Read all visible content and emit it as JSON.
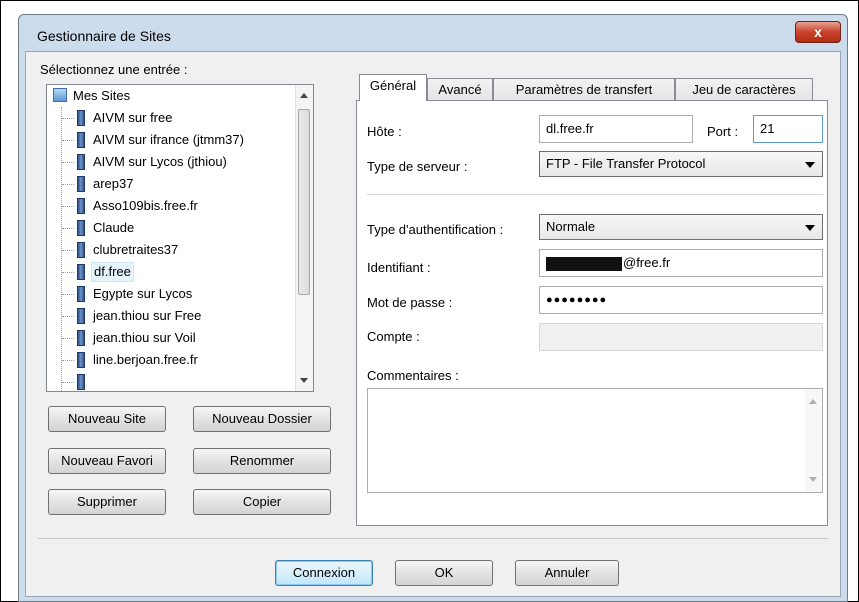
{
  "window": {
    "title": "Gestionnaire de Sites",
    "close_glyph": "x"
  },
  "site_list": {
    "label": "Sélectionnez une entrée :",
    "root": "Mes Sites",
    "items": [
      "AIVM sur free",
      "AIVM sur ifrance (jtmm37)",
      "AIVM sur Lycos (jthiou)",
      "arep37",
      "Asso109bis.free.fr",
      "Claude",
      "clubretraites37",
      "df.free",
      "Egypte sur Lycos",
      "jean.thiou sur Free",
      "jean.thiou sur Voil",
      "line.berjoan.free.fr"
    ],
    "selected": "df.free"
  },
  "buttons": {
    "new_site": "Nouveau Site",
    "new_folder": "Nouveau Dossier",
    "new_bookmark": "Nouveau Favori",
    "rename": "Renommer",
    "delete": "Supprimer",
    "copy": "Copier",
    "connect": "Connexion",
    "ok": "OK",
    "cancel": "Annuler"
  },
  "tabs": [
    "Général",
    "Avancé",
    "Paramètres de transfert",
    "Jeu de caractères"
  ],
  "active_tab": "Général",
  "general": {
    "host_label": "Hôte :",
    "host_value": "dl.free.fr",
    "port_label": "Port :",
    "port_value": "21",
    "server_type_label": "Type de serveur :",
    "server_type_value": "FTP - File Transfer Protocol",
    "auth_type_label": "Type d'authentification :",
    "auth_type_value": "Normale",
    "login_label": "Identifiant :",
    "login_value_suffix": "@free.fr",
    "password_label": "Mot de passe :",
    "password_value": "●●●●●●●●",
    "account_label": "Compte :",
    "account_value": "",
    "comments_label": "Commentaires :",
    "comments_value": ""
  }
}
